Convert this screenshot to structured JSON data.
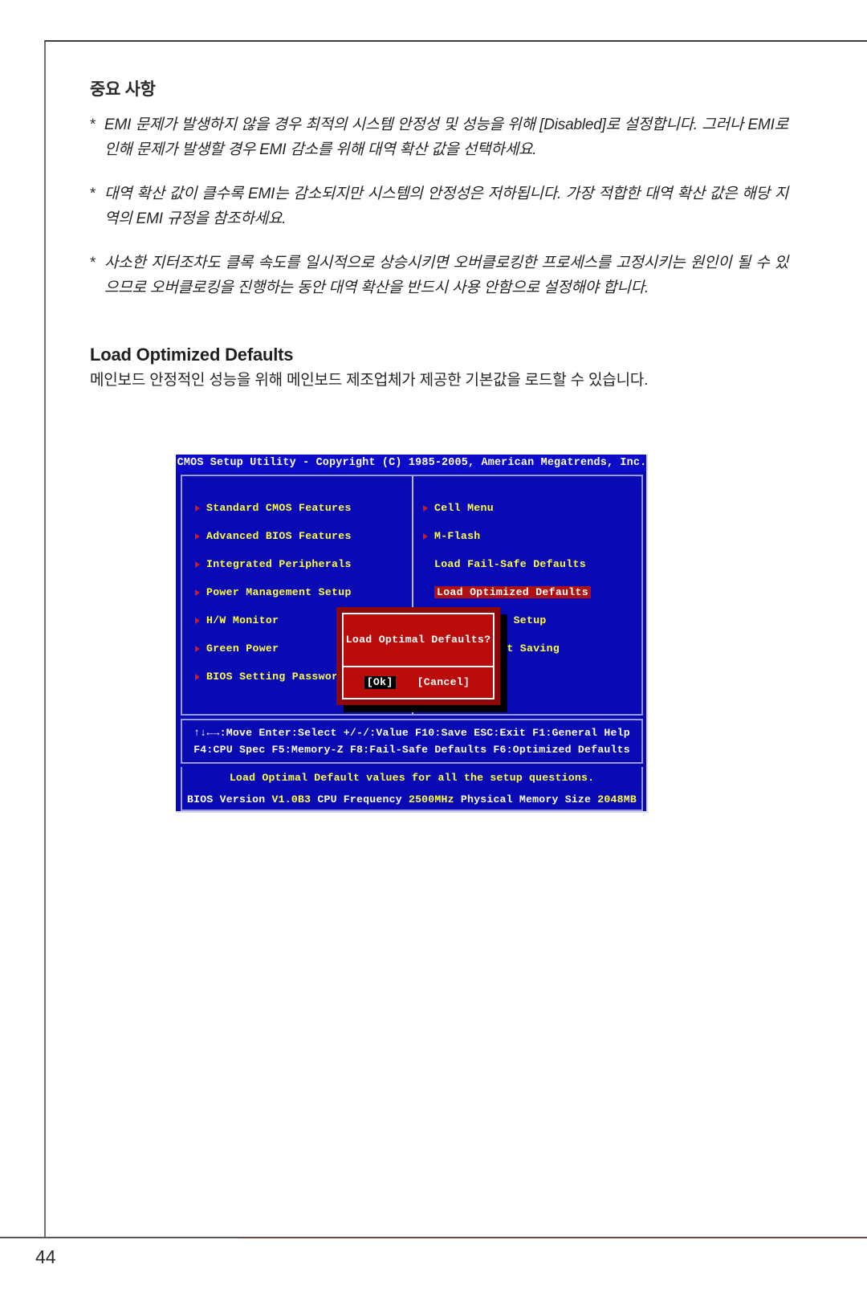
{
  "page": {
    "number": "44"
  },
  "note": {
    "heading": "중요 사항",
    "bullet_mark": "*",
    "bullets": [
      "EMI 문제가 발생하지 않을 경우 최적의 시스템 안정성 및 성능을 위해 [Disabled]로 설정합니다. 그러나 EMI로 인해 문제가 발생할 경우 EMI 감소를 위해 대역 확산 값을 선택하세요.",
      "대역 확산 값이 클수록 EMI는 감소되지만 시스템의 안정성은 저하됩니다. 가장 적합한 대역 확산 값은 해당 지역의 EMI 규정을 참조하세요.",
      "사소한 지터조차도 클록 속도를 일시적으로 상승시키면 오버클로킹한 프로세스를 고정시키는 원인이 될 수 있으므로 오버클로킹을 진행하는 동안 대역 확산을 반드시 사용 안함으로 설정해야 합니다."
    ]
  },
  "section": {
    "heading": "Load Optimized Defaults",
    "body": "메인보드 안정적인 성능을 위해 메인보드 제조업체가 제공한 기본값을 로드할 수 있습니다."
  },
  "bios": {
    "titlebar": "CMOS Setup Utility - Copyright (C) 1985-2005, American Megatrends, Inc.",
    "left_menu": [
      "Standard CMOS Features",
      "Advanced BIOS Features",
      "Integrated Peripherals",
      "Power Management Setup",
      "H/W Monitor",
      "Green Power",
      "BIOS Setting Password"
    ],
    "right_menu": [
      "Cell Menu",
      "M-Flash",
      "Load Fail-Safe Defaults",
      "Load Optimized Defaults",
      "Save & Exit Setup",
      "Exit Without Saving"
    ],
    "dialog": {
      "message": "Load Optimal Defaults?",
      "ok_label": "[Ok]",
      "cancel_label": "[Cancel]"
    },
    "help_line_1": "↑↓←→:Move  Enter:Select  +/-/:Value  F10:Save  ESC:Exit  F1:General Help",
    "help_line_2": "F4:CPU Spec  F5:Memory-Z  F8:Fail-Safe Defaults    F6:Optimized Defaults",
    "description": "Load Optimal Default values for all the setup questions.",
    "status": {
      "bios_version_label": "BIOS Version",
      "bios_version_value": "V1.0B3",
      "cpu_frequency_label": "CPU Frequency",
      "cpu_frequency_value": "2500MHz",
      "memory_label": "Physical Memory Size",
      "memory_value": "2048MB"
    },
    "colors": {
      "screen_blue": "#0a0ab4",
      "menu_yellow": "#ffff44",
      "highlight_red": "#b01010",
      "dialog_red": "#bb0c0c",
      "dialog_border_red": "#8d0808"
    }
  }
}
